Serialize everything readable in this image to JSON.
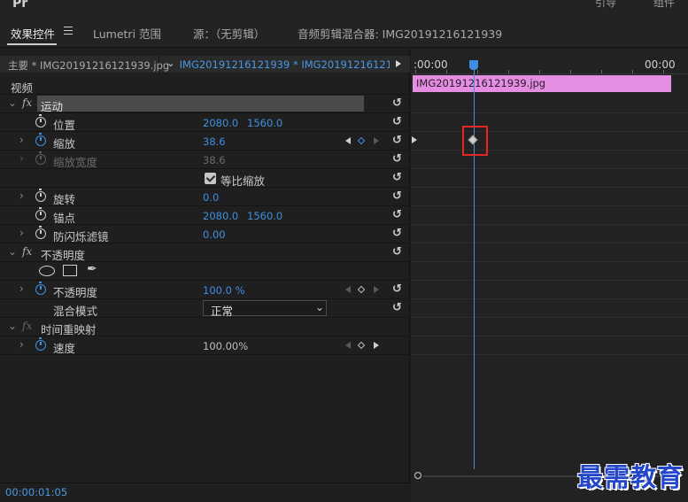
{
  "topstrip": {
    "logo": "Pr",
    "right_items": [
      "引导",
      "组件"
    ]
  },
  "tabs": [
    {
      "label": "效果控件",
      "active": true
    },
    {
      "label": "Lumetri 范围",
      "active": false
    },
    {
      "label": "源：（无剪辑）",
      "active": false
    },
    {
      "label": "音频剪辑混合器: IMG20191216121939",
      "active": false
    }
  ],
  "header": {
    "master": "主要 * IMG20191216121939.jpg",
    "clip": "IMG20191216121939 * IMG20191216121939..."
  },
  "section_video": "视频",
  "motion": {
    "label": "运动",
    "position": {
      "label": "位置",
      "x": "2080.0",
      "y": "1560.0"
    },
    "scale": {
      "label": "缩放",
      "value": "38.6"
    },
    "scale_width": {
      "label": "缩放宽度",
      "value": "38.6"
    },
    "uniform_scale": {
      "label": "等比缩放",
      "checked": true
    },
    "rotation": {
      "label": "旋转",
      "value": "0.0"
    },
    "anchor": {
      "label": "锚点",
      "x": "2080.0",
      "y": "1560.0"
    },
    "flicker": {
      "label": "防闪烁滤镜",
      "value": "0.00"
    }
  },
  "opacity": {
    "label": "不透明度",
    "property": {
      "label": "不透明度",
      "value": "100.0 %"
    },
    "blend": {
      "label": "混合模式",
      "value": "正常"
    }
  },
  "time_remap": {
    "label": "时间重映射",
    "speed": {
      "label": "速度",
      "value": "100.00%"
    }
  },
  "timecode": "00:00:01:05",
  "timeline": {
    "tc_left": ":00:00",
    "tc_right": "00:00",
    "clip_name": "IMG20191216121939.jpg"
  },
  "watermark": "最需教育",
  "colors": {
    "accent": "#3f8fe0",
    "clip": "#e48ee2",
    "highlight": "#e32626"
  }
}
